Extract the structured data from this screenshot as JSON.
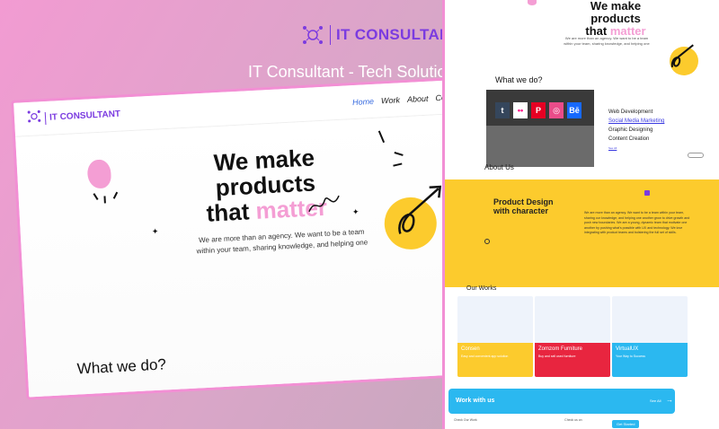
{
  "brand": {
    "text": "IT CONSULTANT",
    "accent": "#7b3be0"
  },
  "caption": "IT Consultant - Tech Solutions",
  "left_mock": {
    "nav_logo": "IT CONSULTANT",
    "menu": [
      "Home",
      "Work",
      "About",
      "Contact"
    ],
    "headline_line1": "We make products",
    "headline_that": "that",
    "headline_accent": "matter",
    "description": "We are more than an agency. We want to be a team within your team, sharing knowledge, and helping one",
    "section_title": "What we do?"
  },
  "right_mock": {
    "headline_line1": "We make products",
    "headline_that": "that",
    "headline_accent": "matter",
    "small_text": "We are more than an agency. We want to be a team within your team, sharing knowledge, and helping one",
    "whatwedo": "What we do?",
    "services": [
      "Web Development",
      "Social Media Marketing",
      "Graphic Designing",
      "Content Creation"
    ],
    "services_more": "See All",
    "about": "About Us",
    "product_title": "Product Design with character",
    "product_text": "We are more than an agency. We want to be a team within your team, sharing our knowledge, and helping one another grow to drive growth and push new boundaries. We are a young, dynamic team that motivate one another by pushing what's possible with UX and technology. We love integrating with product teams and bolstering the full set of skills.",
    "works_title": "Our Works",
    "works": [
      {
        "name": "Consen",
        "sub": "Easy and convenient app solution",
        "color": "#fccb2d"
      },
      {
        "name": "Zomzom Furniture",
        "sub": "Buy and sell used furniture",
        "color": "#e8253f"
      },
      {
        "name": "VirtualUX",
        "sub": "Your Way to Success",
        "color": "#2bb8f0"
      }
    ],
    "work_with": "Work with us",
    "see_all": "See All",
    "get_started": "Get Started",
    "footer": [
      "Check Our Work",
      "Check us on",
      ""
    ]
  }
}
